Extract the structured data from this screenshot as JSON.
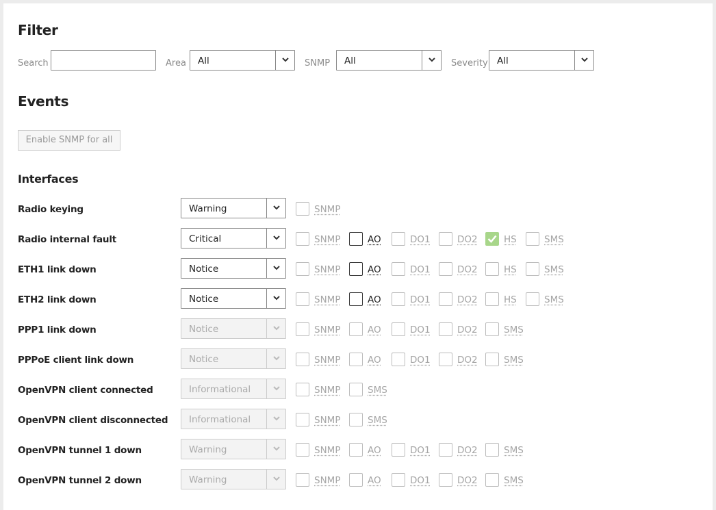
{
  "filter": {
    "title": "Filter",
    "search_label": "Search",
    "search_value": "",
    "area_label": "Area",
    "area_value": "All",
    "snmp_label": "SNMP",
    "snmp_value": "All",
    "severity_label": "Severity",
    "severity_value": "All"
  },
  "events": {
    "title": "Events",
    "enable_button": "Enable SNMP for all"
  },
  "interfaces": {
    "title": "Interfaces",
    "rows": [
      {
        "label": "Radio keying",
        "severity": "Warning",
        "enabled": true,
        "checks": [
          {
            "name": "SNMP",
            "checked": false,
            "active": false
          }
        ]
      },
      {
        "label": "Radio internal fault",
        "severity": "Critical",
        "enabled": true,
        "checks": [
          {
            "name": "SNMP",
            "checked": false,
            "active": false
          },
          {
            "name": "AO",
            "checked": false,
            "active": true
          },
          {
            "name": "DO1",
            "checked": false,
            "active": false
          },
          {
            "name": "DO2",
            "checked": false,
            "active": false
          },
          {
            "name": "HS",
            "checked": true,
            "active": false
          },
          {
            "name": "SMS",
            "checked": false,
            "active": false
          }
        ]
      },
      {
        "label": "ETH1 link down",
        "severity": "Notice",
        "enabled": true,
        "checks": [
          {
            "name": "SNMP",
            "checked": false,
            "active": false
          },
          {
            "name": "AO",
            "checked": false,
            "active": true
          },
          {
            "name": "DO1",
            "checked": false,
            "active": false
          },
          {
            "name": "DO2",
            "checked": false,
            "active": false
          },
          {
            "name": "HS",
            "checked": false,
            "active": false
          },
          {
            "name": "SMS",
            "checked": false,
            "active": false
          }
        ]
      },
      {
        "label": "ETH2 link down",
        "severity": "Notice",
        "enabled": true,
        "checks": [
          {
            "name": "SNMP",
            "checked": false,
            "active": false
          },
          {
            "name": "AO",
            "checked": false,
            "active": true
          },
          {
            "name": "DO1",
            "checked": false,
            "active": false
          },
          {
            "name": "DO2",
            "checked": false,
            "active": false
          },
          {
            "name": "HS",
            "checked": false,
            "active": false
          },
          {
            "name": "SMS",
            "checked": false,
            "active": false
          }
        ]
      },
      {
        "label": "PPP1 link down",
        "severity": "Notice",
        "enabled": false,
        "checks": [
          {
            "name": "SNMP",
            "checked": false,
            "active": false
          },
          {
            "name": "AO",
            "checked": false,
            "active": false
          },
          {
            "name": "DO1",
            "checked": false,
            "active": false
          },
          {
            "name": "DO2",
            "checked": false,
            "active": false
          },
          {
            "name": "SMS",
            "checked": false,
            "active": false
          }
        ]
      },
      {
        "label": "PPPoE client link down",
        "severity": "Notice",
        "enabled": false,
        "checks": [
          {
            "name": "SNMP",
            "checked": false,
            "active": false
          },
          {
            "name": "AO",
            "checked": false,
            "active": false
          },
          {
            "name": "DO1",
            "checked": false,
            "active": false
          },
          {
            "name": "DO2",
            "checked": false,
            "active": false
          },
          {
            "name": "SMS",
            "checked": false,
            "active": false
          }
        ]
      },
      {
        "label": "OpenVPN client connected",
        "severity": "Informational",
        "enabled": false,
        "checks": [
          {
            "name": "SNMP",
            "checked": false,
            "active": false
          },
          {
            "name": "SMS",
            "checked": false,
            "active": false
          }
        ]
      },
      {
        "label": "OpenVPN client disconnected",
        "severity": "Informational",
        "enabled": false,
        "checks": [
          {
            "name": "SNMP",
            "checked": false,
            "active": false
          },
          {
            "name": "SMS",
            "checked": false,
            "active": false
          }
        ]
      },
      {
        "label": "OpenVPN tunnel 1 down",
        "severity": "Warning",
        "enabled": false,
        "checks": [
          {
            "name": "SNMP",
            "checked": false,
            "active": false
          },
          {
            "name": "AO",
            "checked": false,
            "active": false
          },
          {
            "name": "DO1",
            "checked": false,
            "active": false
          },
          {
            "name": "DO2",
            "checked": false,
            "active": false
          },
          {
            "name": "SMS",
            "checked": false,
            "active": false
          }
        ]
      },
      {
        "label": "OpenVPN tunnel 2 down",
        "severity": "Warning",
        "enabled": false,
        "checks": [
          {
            "name": "SNMP",
            "checked": false,
            "active": false
          },
          {
            "name": "AO",
            "checked": false,
            "active": false
          },
          {
            "name": "DO1",
            "checked": false,
            "active": false
          },
          {
            "name": "DO2",
            "checked": false,
            "active": false
          },
          {
            "name": "SMS",
            "checked": false,
            "active": false
          }
        ]
      }
    ]
  },
  "colors": {
    "checked": "#a8d68a",
    "muted_text": "#a5a5a5",
    "page_bg": "#ececec"
  }
}
